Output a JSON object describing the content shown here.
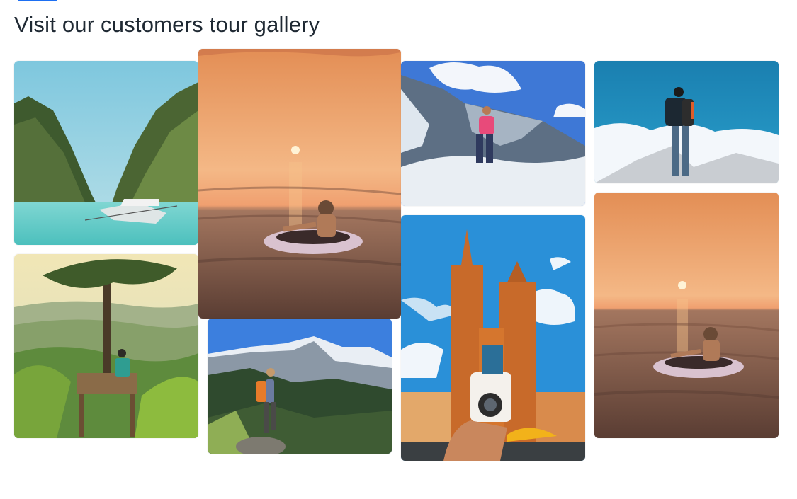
{
  "gallery": {
    "title": "Visit our customers tour gallery",
    "images": [
      {
        "id": "lagoon-boat",
        "subject": "boat in tropical lagoon between limestone cliffs"
      },
      {
        "id": "sunset-float-1",
        "subject": "person on inflatable ring at sunset sea"
      },
      {
        "id": "snow-climber",
        "subject": "climber in pink jacket on snowy mountain"
      },
      {
        "id": "hiker-clouds",
        "subject": "hiker with backpack above clouds"
      },
      {
        "id": "treehouse-view",
        "subject": "person sitting on tree platform over green valley"
      },
      {
        "id": "valley-hiker",
        "subject": "hiker with orange backpack facing snowy peaks"
      },
      {
        "id": "church-instant-camera",
        "subject": "instant camera held before brick church towers"
      },
      {
        "id": "sunset-float-2",
        "subject": "person on inflatable ring at sunset sea"
      }
    ]
  },
  "colors": {
    "accent": "#1d6ff2",
    "title_text": "#1f2933"
  }
}
